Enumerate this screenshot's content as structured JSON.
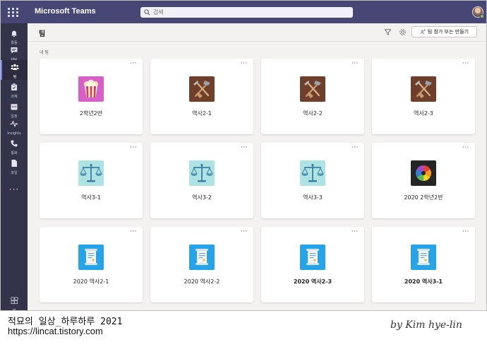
{
  "app": {
    "name": "Microsoft Teams",
    "search_placeholder": "검색"
  },
  "rail": [
    {
      "label": "활동",
      "icon": "bell-icon"
    },
    {
      "label": "채팅",
      "icon": "chat-icon"
    },
    {
      "label": "팀",
      "icon": "teams-icon",
      "active": true
    },
    {
      "label": "과제",
      "icon": "assignments-icon"
    },
    {
      "label": "일정",
      "icon": "calendar-icon"
    },
    {
      "label": "Insights",
      "icon": "insights-icon"
    },
    {
      "label": "통화",
      "icon": "phone-icon"
    },
    {
      "label": "파일",
      "icon": "files-icon"
    }
  ],
  "rail_more": "···",
  "rail_apps": {
    "label": "앱",
    "icon": "apps-icon"
  },
  "header": {
    "title": "팀",
    "join_button": "팀 참가 또는 만들기"
  },
  "section_label": "내 팀",
  "teams": [
    {
      "name": "2학년2반",
      "icon": "popcorn",
      "bold": false
    },
    {
      "name": "역사2-1",
      "icon": "tools",
      "bold": false
    },
    {
      "name": "역사2-2",
      "icon": "tools",
      "bold": false
    },
    {
      "name": "역사2-3",
      "icon": "tools",
      "bold": false
    },
    {
      "name": "역사3-1",
      "icon": "scale",
      "bold": false
    },
    {
      "name": "역사3-2",
      "icon": "scale",
      "bold": false
    },
    {
      "name": "역사3-3",
      "icon": "scale",
      "bold": false
    },
    {
      "name": "2020 2학년2반",
      "icon": "colorwheel",
      "bold": false
    },
    {
      "name": "2020 역사2-1",
      "icon": "scroll",
      "bold": false
    },
    {
      "name": "2020 역사2-2",
      "icon": "scroll",
      "bold": false
    },
    {
      "name": "2020 역사2-3",
      "icon": "scroll",
      "bold": true
    },
    {
      "name": "2020 역사3-1",
      "icon": "scroll",
      "bold": true
    }
  ],
  "card_more": "···",
  "watermark": {
    "line1": "적묘의 일상_하루하루 2021",
    "line2": "https://lincat.tistory.com",
    "signature": "by Kim hye-lin"
  },
  "colors": {
    "titlebar": "#464775",
    "rail": "#33344a",
    "accent": "#7b83eb",
    "background": "#f3f2f1"
  }
}
